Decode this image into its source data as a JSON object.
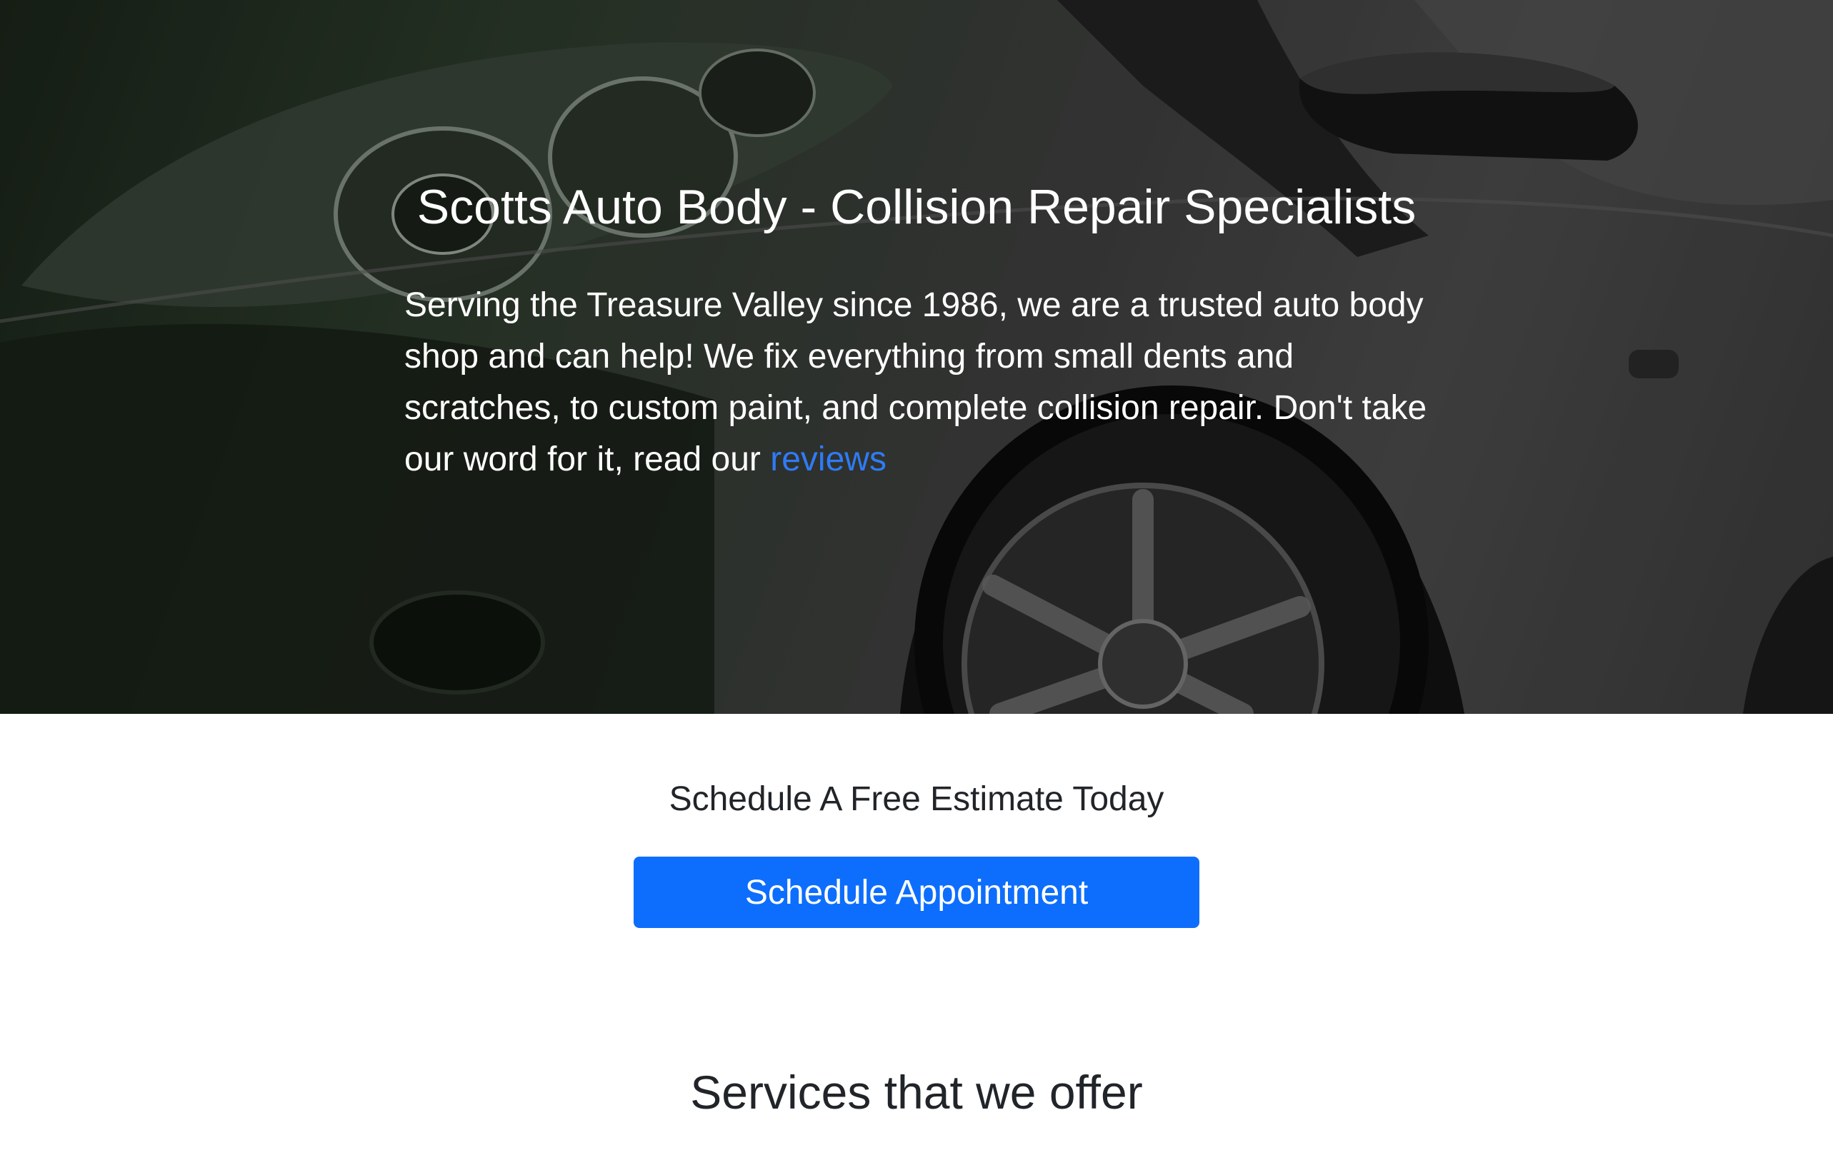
{
  "hero": {
    "title": "Scotts Auto Body - Collision Repair Specialists",
    "text_before_link": "Serving the Treasure Valley since 1986, we are a trusted auto body shop and can help! We fix everything from small dents and scratches, to custom paint, and complete collision repair. Don't take our word for it, read our ",
    "link_label": "reviews",
    "background_image": "car-front-photo"
  },
  "cta": {
    "heading": "Schedule A Free Estimate Today",
    "button_label": "Schedule Appointment"
  },
  "services": {
    "heading": "Services that we offer"
  },
  "colors": {
    "accent": "#0d6efd",
    "link": "#2f7bf5",
    "heading_text": "#212529"
  }
}
